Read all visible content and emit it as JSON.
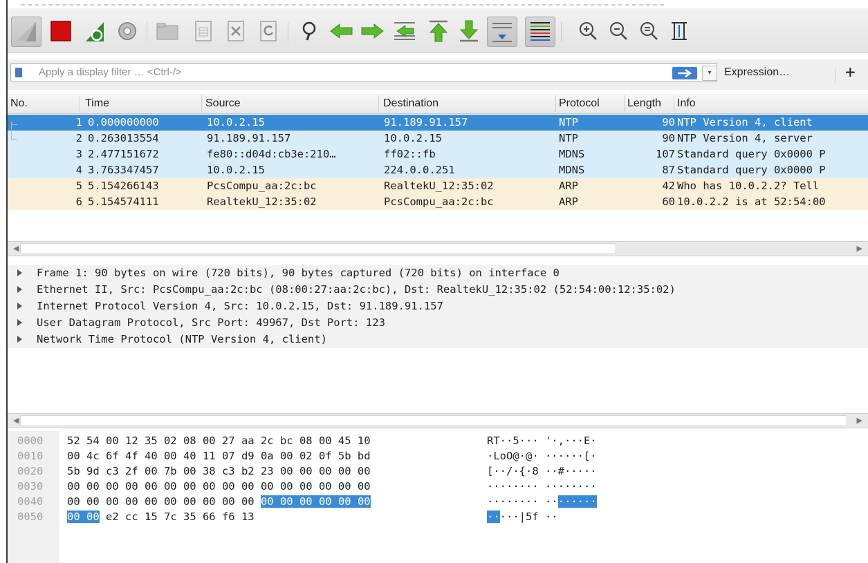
{
  "toolbar": {
    "buttons": [
      {
        "name": "start-capture-icon"
      },
      {
        "name": "stop-capture-icon"
      },
      {
        "name": "restart-capture-icon"
      },
      {
        "name": "capture-options-icon"
      },
      {
        "name": "open-file-icon"
      },
      {
        "name": "save-file-icon"
      },
      {
        "name": "close-file-icon"
      },
      {
        "name": "reload-file-icon"
      },
      {
        "name": "find-packet-icon"
      },
      {
        "name": "go-back-icon"
      },
      {
        "name": "go-forward-icon"
      },
      {
        "name": "go-to-packet-icon"
      },
      {
        "name": "go-first-packet-icon"
      },
      {
        "name": "go-last-packet-icon"
      },
      {
        "name": "autoscroll-icon"
      },
      {
        "name": "colorize-icon"
      },
      {
        "name": "zoom-in-icon"
      },
      {
        "name": "zoom-out-icon"
      },
      {
        "name": "normal-size-icon"
      },
      {
        "name": "resize-columns-icon"
      }
    ]
  },
  "filter": {
    "placeholder": "Apply a display filter … <Ctrl-/>",
    "expression_label": "Expression…",
    "plus_label": "+"
  },
  "packet_list": {
    "columns": [
      "No.",
      "Time",
      "Source",
      "Destination",
      "Protocol",
      "Length",
      "Info"
    ],
    "rows": [
      {
        "no": "1",
        "time": "0.000000000",
        "source": "10.0.2.15",
        "destination": "91.189.91.157",
        "protocol": "NTP",
        "length": "90",
        "info": "NTP Version 4, client",
        "kind": "sel"
      },
      {
        "no": "2",
        "time": "0.263013554",
        "source": "91.189.91.157",
        "destination": "10.0.2.15",
        "protocol": "NTP",
        "length": "90",
        "info": "NTP Version 4, server",
        "kind": "udp"
      },
      {
        "no": "3",
        "time": "2.477151672",
        "source": "fe80::d04d:cb3e:210…",
        "destination": "ff02::fb",
        "protocol": "MDNS",
        "length": "107",
        "info": "Standard query 0x0000 P",
        "kind": "udp"
      },
      {
        "no": "4",
        "time": "3.763347457",
        "source": "10.0.2.15",
        "destination": "224.0.0.251",
        "protocol": "MDNS",
        "length": "87",
        "info": "Standard query 0x0000 P",
        "kind": "udp"
      },
      {
        "no": "5",
        "time": "5.154266143",
        "source": "PcsCompu_aa:2c:bc",
        "destination": "RealtekU_12:35:02",
        "protocol": "ARP",
        "length": "42",
        "info": "Who has 10.0.2.2? Tell",
        "kind": "arp"
      },
      {
        "no": "6",
        "time": "5.154574111",
        "source": "RealtekU_12:35:02",
        "destination": "PcsCompu_aa:2c:bc",
        "protocol": "ARP",
        "length": "60",
        "info": "10.0.2.2 is at 52:54:00",
        "kind": "arp"
      }
    ]
  },
  "details": {
    "lines": [
      "Frame 1: 90 bytes on wire (720 bits), 90 bytes captured (720 bits) on interface 0",
      "Ethernet II, Src: PcsCompu_aa:2c:bc (08:00:27:aa:2c:bc), Dst: RealtekU_12:35:02 (52:54:00:12:35:02)",
      "Internet Protocol Version 4, Src: 10.0.2.15, Dst: 91.189.91.157",
      "User Datagram Protocol, Src Port: 49967, Dst Port: 123",
      "Network Time Protocol (NTP Version 4, client)"
    ]
  },
  "hex": {
    "rows": [
      {
        "offset": "0000",
        "bytes_a": "52 54 00 12 35 02 08 00  27 aa 2c bc 08 00 45 10",
        "bytes_hl": "",
        "bytes_b": "",
        "ascii_a": "RT··5··· '·,···E·",
        "ascii_hl": "",
        "ascii_b": ""
      },
      {
        "offset": "0010",
        "bytes_a": "00 4c 6f 4f 40 00 40 11  07 d9 0a 00 02 0f 5b bd",
        "bytes_hl": "",
        "bytes_b": "",
        "ascii_a": "·LoO@·@· ······[·",
        "ascii_hl": "",
        "ascii_b": ""
      },
      {
        "offset": "0020",
        "bytes_a": "5b 9d c3 2f 00 7b 00 38  c3 b2 23 00 00 00 00 00",
        "bytes_hl": "",
        "bytes_b": "",
        "ascii_a": "[··/·{·8 ··#·····",
        "ascii_hl": "",
        "ascii_b": ""
      },
      {
        "offset": "0030",
        "bytes_a": "00 00 00 00 00 00 00 00  00 00 00 00 00 00 00 00",
        "bytes_hl": "",
        "bytes_b": "",
        "ascii_a": "········ ········",
        "ascii_hl": "",
        "ascii_b": ""
      },
      {
        "offset": "0040",
        "bytes_a": "00 00 00 00 00 00 00 00  00 00 ",
        "bytes_hl": "00 00 00 00 00 00",
        "bytes_b": "",
        "ascii_a": "········ ··",
        "ascii_hl": "······",
        "ascii_b": ""
      },
      {
        "offset": "0050",
        "bytes_a": "",
        "bytes_hl": "00 00",
        "bytes_b": " e2 cc 15 7c 35 66  f6 13",
        "ascii_a": "",
        "ascii_hl": "··",
        "ascii_b": "···|5f ··"
      }
    ]
  },
  "colors": {
    "selected_row": "#3a8bd6",
    "udp_row": "#d9ecfa",
    "arp_row": "#faefd8"
  }
}
